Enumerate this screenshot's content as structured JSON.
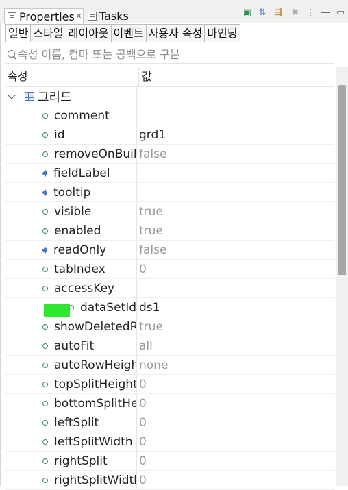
{
  "view_tabs": [
    {
      "label": "Properties",
      "active": true
    },
    {
      "label": "Tasks",
      "active": false
    }
  ],
  "toolbar_icons": [
    "pin-icon",
    "sort-icon",
    "filter-icon",
    "clear-icon",
    "more-icon",
    "minimize-icon",
    "maximize-icon"
  ],
  "category_tabs": [
    "일반",
    "스타일",
    "레이아웃",
    "이벤트",
    "사용자 속성",
    "바인딩"
  ],
  "filter": {
    "placeholder": "속성 이름, 컴마 또는 공백으로 구분"
  },
  "header": {
    "property": "속성",
    "value": "값"
  },
  "group": {
    "label": "그리드"
  },
  "rows": [
    {
      "name": "comment",
      "value": "",
      "icon": "property",
      "dim": false
    },
    {
      "name": "id",
      "value": "grd1",
      "icon": "property",
      "dim": false
    },
    {
      "name": "removeOnBuild",
      "value": "false",
      "icon": "property",
      "dim": true
    },
    {
      "name": "fieldLabel",
      "value": "",
      "icon": "event",
      "dim": false
    },
    {
      "name": "tooltip",
      "value": "",
      "icon": "event",
      "dim": false
    },
    {
      "name": "visible",
      "value": "true",
      "icon": "property",
      "dim": true
    },
    {
      "name": "enabled",
      "value": "true",
      "icon": "property",
      "dim": true
    },
    {
      "name": "readOnly",
      "value": "false",
      "icon": "event",
      "dim": true
    },
    {
      "name": "tabIndex",
      "value": "0",
      "icon": "property",
      "dim": true
    },
    {
      "name": "accessKey",
      "value": "",
      "icon": "property",
      "dim": false
    },
    {
      "name": "dataSetId",
      "value": "ds1",
      "icon": "property",
      "dim": false,
      "highlight": true
    },
    {
      "name": "showDeletedRows",
      "value": "true",
      "icon": "property",
      "dim": true
    },
    {
      "name": "autoFit",
      "value": "all",
      "icon": "property",
      "dim": true
    },
    {
      "name": "autoRowHeight",
      "value": "none",
      "icon": "property",
      "dim": true
    },
    {
      "name": "topSplitHeight",
      "value": "0",
      "icon": "property",
      "dim": true
    },
    {
      "name": "bottomSplitHeight",
      "value": "0",
      "icon": "property",
      "dim": true
    },
    {
      "name": "leftSplit",
      "value": "0",
      "icon": "property",
      "dim": true
    },
    {
      "name": "leftSplitWidth",
      "value": "0",
      "icon": "property",
      "dim": true
    },
    {
      "name": "rightSplit",
      "value": "0",
      "icon": "property",
      "dim": true
    },
    {
      "name": "rightSplitWidth",
      "value": "0",
      "icon": "property",
      "dim": true
    }
  ],
  "colors": {
    "highlight": "#2ee82e",
    "property_dot": "#3f8a5d",
    "event_icon": "#4f77c8"
  }
}
